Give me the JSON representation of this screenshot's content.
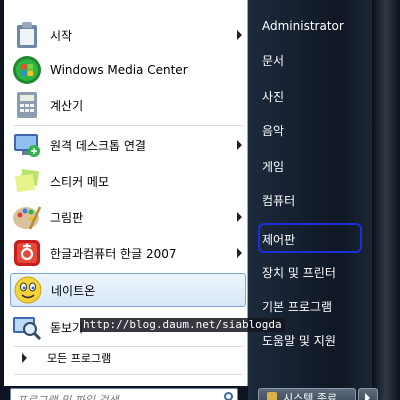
{
  "left_pane": {
    "items": [
      {
        "label": "시작",
        "icon": "clipboard-icon",
        "has_arrow": true
      },
      {
        "label": "Windows Media Center",
        "icon": "windows-media-center-icon",
        "has_arrow": false
      },
      {
        "label": "계산기",
        "icon": "calculator-icon",
        "has_arrow": false
      },
      {
        "label": "원격 데스크톱 연결",
        "icon": "remote-desktop-icon",
        "has_arrow": true
      },
      {
        "label": "스티커 메모",
        "icon": "sticky-notes-icon",
        "has_arrow": false
      },
      {
        "label": "그림판",
        "icon": "paint-icon",
        "has_arrow": true
      },
      {
        "label": "한글과컴퓨터 한글 2007",
        "icon": "hangul-icon",
        "has_arrow": true
      },
      {
        "label": "네이트온",
        "icon": "nateon-icon",
        "has_arrow": false,
        "selected": true
      },
      {
        "label": "돋보기",
        "icon": "magnifier-icon",
        "has_arrow": false
      }
    ],
    "all_programs": "모든 프로그램",
    "search_placeholder": "프로그램 및 파일 검색"
  },
  "right_pane": {
    "items": [
      "Administrator",
      "문서",
      "사진",
      "음악",
      "게임",
      "컴퓨터",
      "제어판",
      "장치 및 프린터",
      "기본 프로그램",
      "도움말 및 지원"
    ],
    "highlighted": "제어판",
    "highlight_color": "#1b30d8",
    "shutdown_label": "시스템 종료"
  },
  "watermark": "http://blog.daum.net/siablogda"
}
